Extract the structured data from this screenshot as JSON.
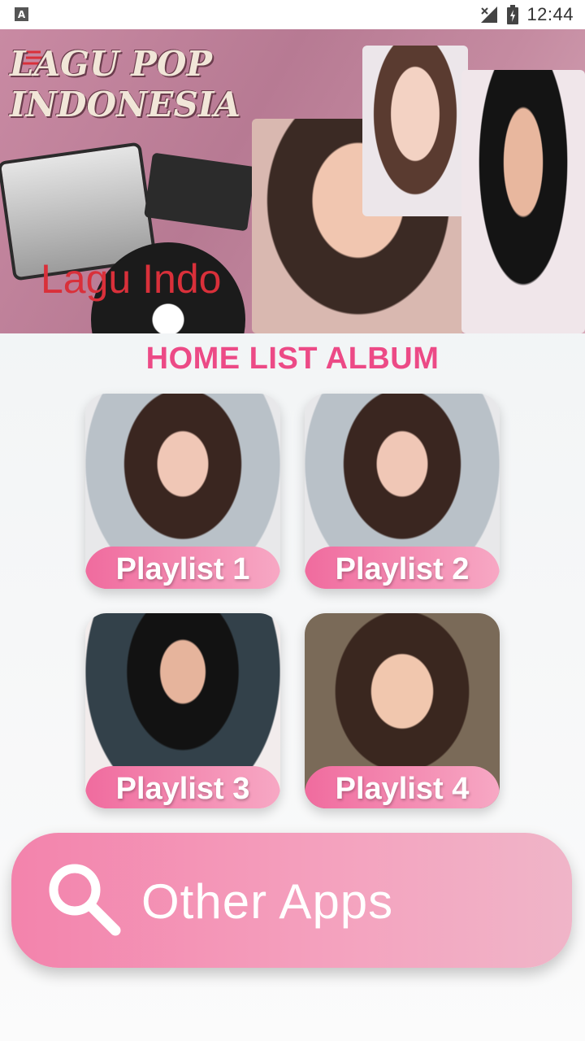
{
  "status_bar": {
    "notification_icon": "A",
    "time": "12:44"
  },
  "banner": {
    "title_line1": "LAGU POP",
    "title_line2": "INDONESIA",
    "subtitle": "Lagu Indo"
  },
  "home": {
    "heading": "HOME LIST ALBUM"
  },
  "playlists": [
    {
      "label": "Playlist 1"
    },
    {
      "label": "Playlist 2"
    },
    {
      "label": "Playlist 3"
    },
    {
      "label": "Playlist 4"
    }
  ],
  "other_apps": {
    "label": "Other Apps"
  },
  "colors": {
    "accent_pink": "#ec4a86",
    "button_pink": "#f383ac",
    "banner_subtitle_red": "#d9303a"
  },
  "icons": [
    "notification-icon",
    "signal-icon",
    "battery-icon",
    "search-icon"
  ]
}
